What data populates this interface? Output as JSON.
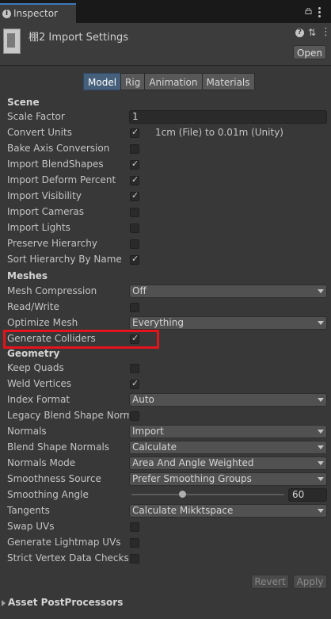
{
  "tab": {
    "title": "Inspector"
  },
  "header": {
    "title": "棚2 Import Settings",
    "open_label": "Open"
  },
  "tabs": [
    "Model",
    "Rig",
    "Animation",
    "Materials"
  ],
  "scene": {
    "heading": "Scene",
    "scale_factor_label": "Scale Factor",
    "scale_factor_value": "1",
    "convert_units_label": "Convert Units",
    "convert_units_note": "1cm (File) to 0.01m (Unity)",
    "bake_axis_label": "Bake Axis Conversion",
    "blendshapes_label": "Import BlendShapes",
    "deform_percent_label": "Import Deform Percent",
    "visibility_label": "Import Visibility",
    "cameras_label": "Import Cameras",
    "lights_label": "Import Lights",
    "preserve_hierarchy_label": "Preserve Hierarchy",
    "sort_hierarchy_label": "Sort Hierarchy By Name"
  },
  "meshes": {
    "heading": "Meshes",
    "compression_label": "Mesh Compression",
    "compression_value": "Off",
    "read_write_label": "Read/Write",
    "optimize_label": "Optimize Mesh",
    "optimize_value": "Everything",
    "colliders_label": "Generate Colliders"
  },
  "geometry": {
    "heading": "Geometry",
    "keep_quads_label": "Keep Quads",
    "weld_label": "Weld Vertices",
    "index_format_label": "Index Format",
    "index_format_value": "Auto",
    "legacy_blend_label": "Legacy Blend Shape Normals",
    "normals_label": "Normals",
    "normals_value": "Import",
    "blend_normals_label": "Blend Shape Normals",
    "blend_normals_value": "Calculate",
    "normals_mode_label": "Normals Mode",
    "normals_mode_value": "Area And Angle Weighted",
    "smoothness_label": "Smoothness Source",
    "smoothness_value": "Prefer Smoothing Groups",
    "smoothing_angle_label": "Smoothing Angle",
    "smoothing_angle_value": "60",
    "tangents_label": "Tangents",
    "tangents_value": "Calculate Mikktspace",
    "swap_uvs_label": "Swap UVs",
    "lightmap_uvs_label": "Generate Lightmap UVs",
    "strict_label": "Strict Vertex Data Checks"
  },
  "footer": {
    "revert_label": "Revert",
    "apply_label": "Apply",
    "postprocessors_label": "Asset PostProcessors"
  },
  "colors": {
    "highlight": "#e3141b",
    "active_tab": "#46607c"
  }
}
